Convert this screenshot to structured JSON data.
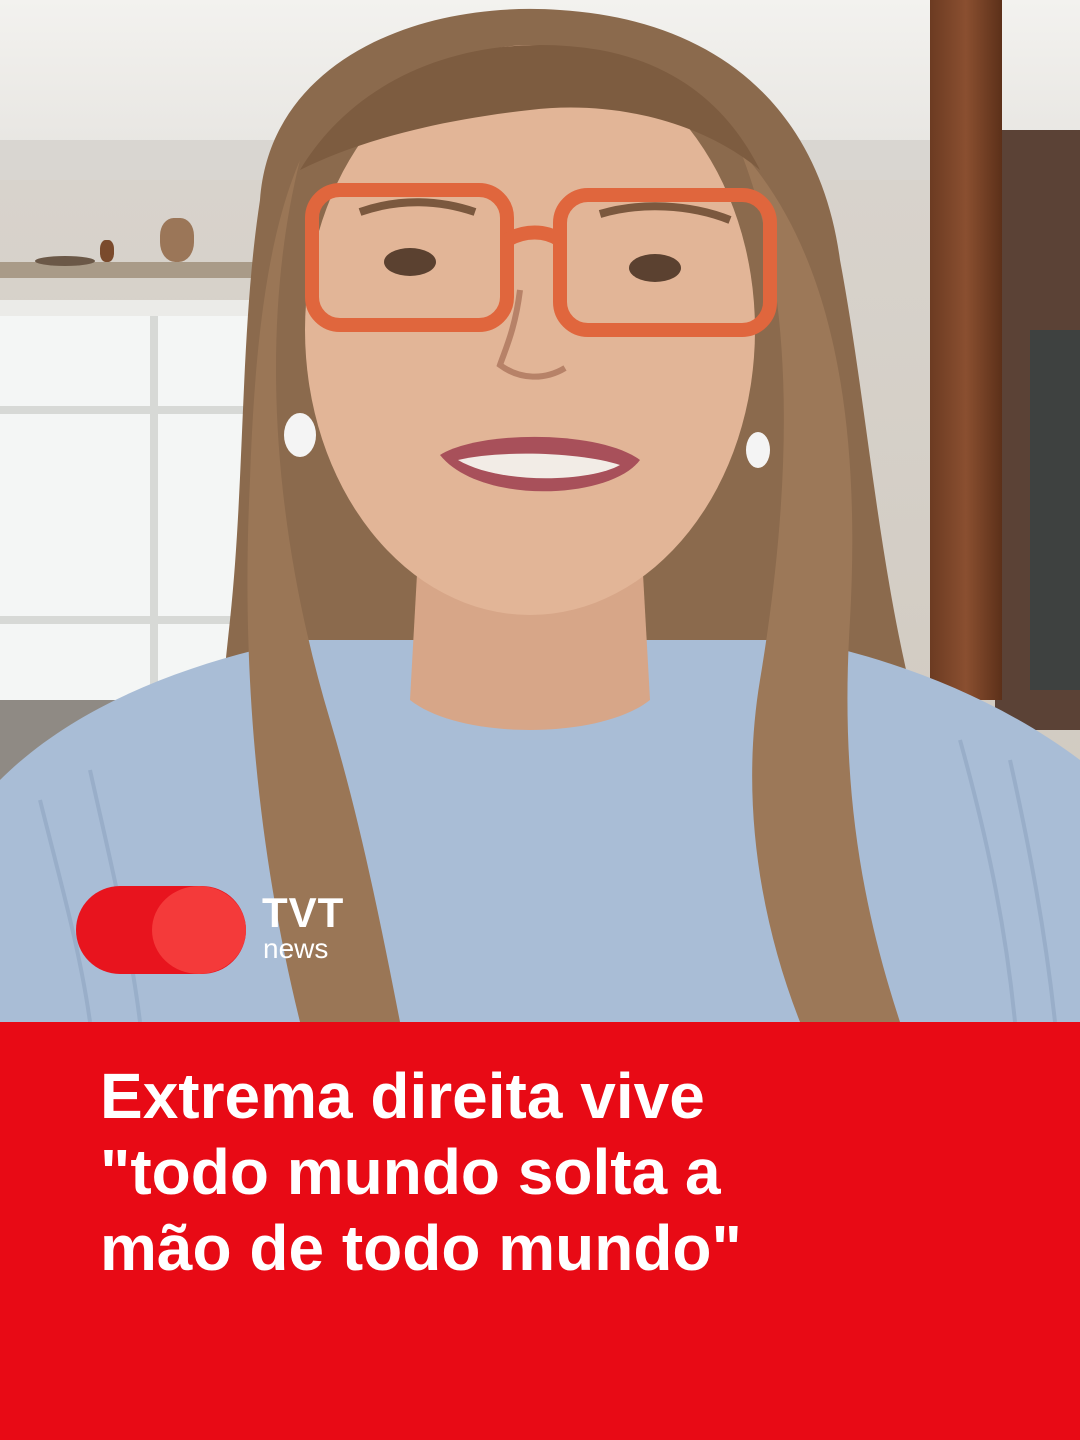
{
  "logo": {
    "brand": "TVT",
    "sub": "news",
    "colors": {
      "pill": "#e8141e",
      "dot": "#f43a3a",
      "text": "#ffffff"
    }
  },
  "headline": {
    "lines": [
      "Extrema direita vive",
      "\"todo mundo solta a",
      "mão de todo mundo\""
    ]
  },
  "colors": {
    "band": "#e80a15"
  }
}
